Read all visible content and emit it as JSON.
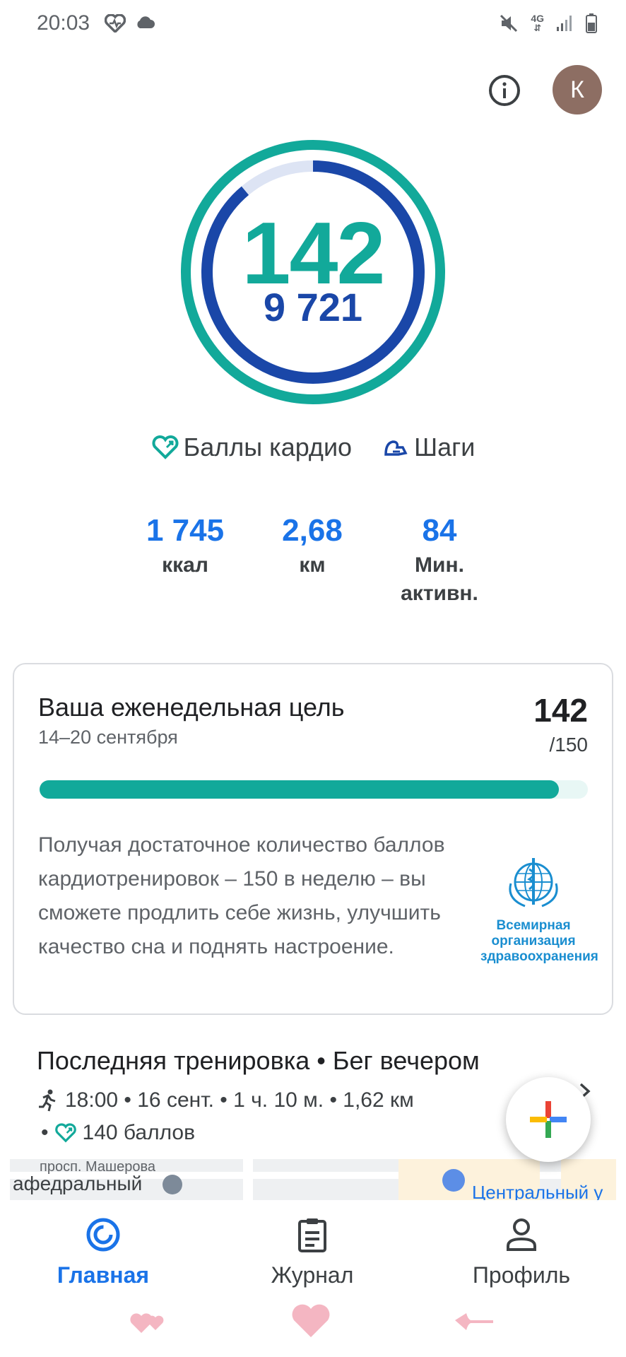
{
  "status_bar": {
    "time": "20:03",
    "network": "4G"
  },
  "header": {
    "avatar_initial": "К"
  },
  "summary": {
    "heart_points": "142",
    "steps": "9 721",
    "colors": {
      "heart_ring": "#12a99a",
      "steps_ring": "#1a47a8"
    }
  },
  "legend": {
    "heart_points_label": "Баллы кардио",
    "steps_label": "Шаги"
  },
  "stats": [
    {
      "value": "1 745",
      "label": "ккал"
    },
    {
      "value": "2,68",
      "label": "км"
    },
    {
      "value": "84",
      "label": "Мин. активн."
    }
  ],
  "weekly_goal": {
    "title": "Ваша еженедельная цель",
    "dates": "14–20 сентября",
    "value": "142",
    "target": "/150",
    "progress_fraction": 0.947,
    "description": "Получая достаточное количество баллов кардиотренировок – 150 в неделю – вы сможете продлить себе жизнь, улучшить качество сна и поднять настроение.",
    "partner": "Всемирная организация здравоохранения"
  },
  "last_workout": {
    "title": "Последняя тренировка • Бег вечером",
    "meta": "18:00 • 16 сент. • 1 ч. 10 м. • 1,62 км",
    "points": "140 баллов",
    "map_street": "просп. Машерова"
  },
  "bottom_nav": {
    "items": [
      {
        "label": "Главная",
        "active": true
      },
      {
        "label": "Журнал",
        "active": false
      },
      {
        "label": "Профиль",
        "active": false
      }
    ]
  }
}
